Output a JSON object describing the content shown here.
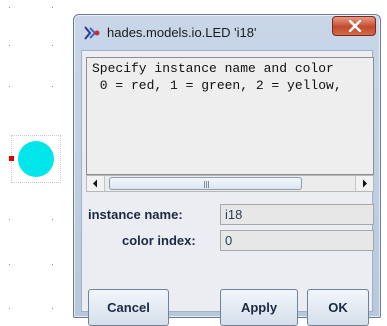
{
  "window": {
    "title": "hades.models.io.LED 'i18'",
    "icon": "hades-app-icon",
    "close_icon": "close-icon"
  },
  "info_text": {
    "lines": [
      "Specify instance name and color",
      " 0 = red, 1 = green, 2 = yellow,"
    ]
  },
  "scrollbar": {
    "left_icon": "scroll-left-arrow-icon",
    "right_icon": "scroll-right-arrow-icon"
  },
  "fields": {
    "instance_name_label": "instance name:",
    "instance_name_value": "i18",
    "color_index_label": "color index:",
    "color_index_value": "0"
  },
  "buttons": {
    "cancel": "Cancel",
    "apply": "Apply",
    "ok": "OK"
  },
  "led": {
    "color": "#00e6ea",
    "pin_color": "#e00000"
  }
}
